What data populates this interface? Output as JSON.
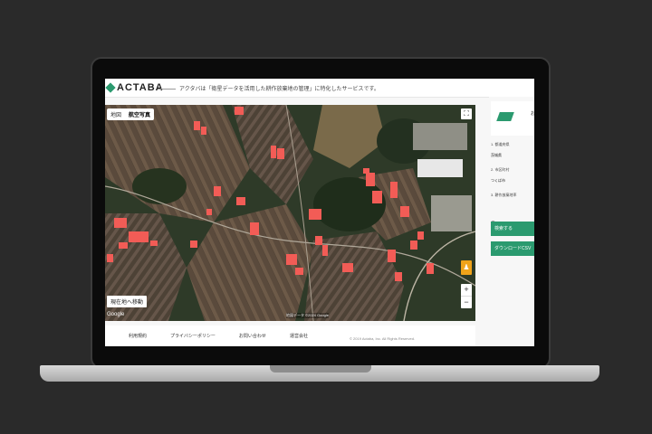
{
  "app": {
    "logo": "ACTABA",
    "tagline": "アクタバは「衛星データを活用した耕作放棄地の管理」に特化したサービスです。",
    "brand_color": "#2b9a6f"
  },
  "map": {
    "tabs": [
      {
        "label": "地図",
        "active": false
      },
      {
        "label": "航空写真",
        "active": true
      }
    ],
    "move_button": "現在地へ移動",
    "google": "Google",
    "attribution": "地図データ ©2024 Google",
    "highlight_color": "#f25c56"
  },
  "footer": {
    "links": [
      "利用規約",
      "プライバシーポリシー",
      "お問い合わせ",
      "運営会社"
    ],
    "copyright": "© 2019 Actaba, Inc. All Rights Reserved."
  },
  "side": {
    "corner_text": "お",
    "fields": [
      {
        "label": "1. 都道府県",
        "value": "茨城県"
      },
      {
        "label": "2. 市区町村",
        "value": "つくば市"
      },
      {
        "label": "3. 耕作放棄地率",
        "value": ""
      }
    ],
    "search_button": "検索する",
    "download_button": "ダウンロードCSV"
  }
}
